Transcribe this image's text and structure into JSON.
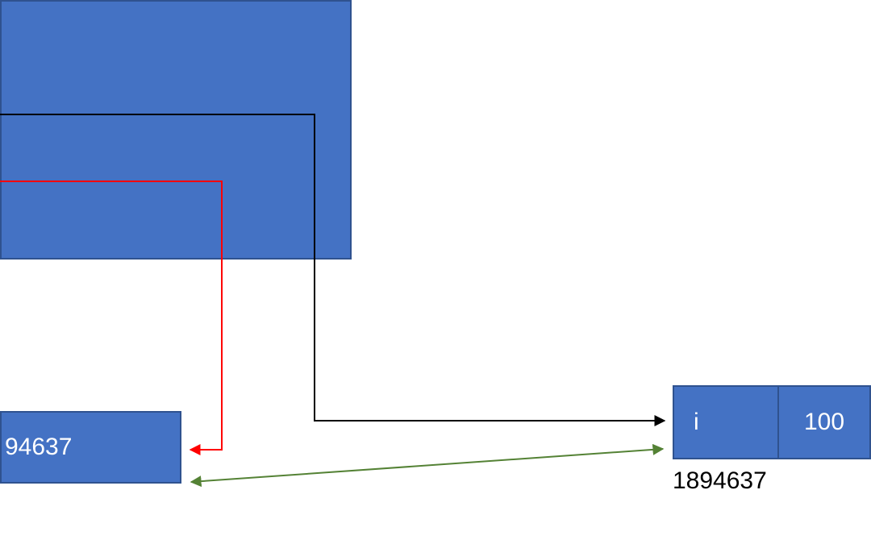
{
  "colors": {
    "node_fill": "#4472c4",
    "node_border": "#2f528f",
    "arrow_black": "#000000",
    "arrow_red": "#ff0000",
    "arrow_green": "#548235"
  },
  "pointer_box": {
    "value": "94637"
  },
  "target_box": {
    "var_name": "i",
    "value": "100"
  },
  "target_address": "1894637"
}
